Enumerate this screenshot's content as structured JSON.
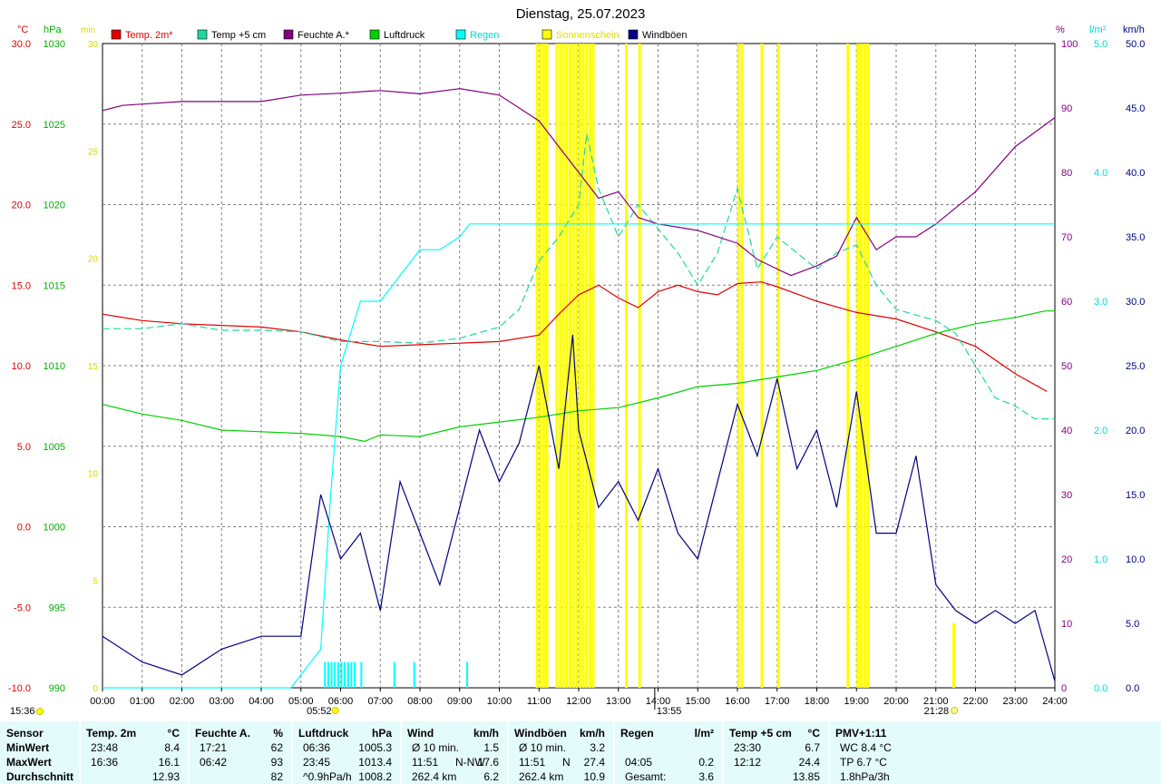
{
  "title": "Dienstag, 25.07.2023",
  "legend": [
    {
      "label": "Temp. 2m*",
      "color": "#e00000",
      "text_color": "#e00000"
    },
    {
      "label": "Temp +5 cm",
      "color": "#20d8a0",
      "text_color": "#000000"
    },
    {
      "label": "Feuchte A.*",
      "color": "#800080",
      "text_color": "#000000"
    },
    {
      "label": "Luftdruck",
      "color": "#00d000",
      "text_color": "#000000"
    },
    {
      "label": "Regen",
      "color": "#00ffff",
      "text_color": "#00d8d8"
    },
    {
      "label": "Sonnenschein",
      "color": "#ffff00",
      "text_color": "#e0e000"
    },
    {
      "label": "Windböen",
      "color": "#000080",
      "text_color": "#000000"
    }
  ],
  "axes": {
    "temp": {
      "unit": "°C",
      "color": "#e00000",
      "ticks": [
        "30.0",
        "25.0",
        "20.0",
        "15.0",
        "10.0",
        "5.0",
        "0.0",
        "-5.0",
        "-10.0"
      ]
    },
    "pressure": {
      "unit": "hPa",
      "color": "#00b000",
      "ticks": [
        "1030",
        "1025",
        "1020",
        "1015",
        "1010",
        "1005",
        "1000",
        "995",
        "990"
      ]
    },
    "sun": {
      "unit": "min",
      "color": "#d8d800",
      "ticks": [
        "30",
        "25",
        "20",
        "15",
        "10",
        "5",
        "0"
      ]
    },
    "humidity": {
      "unit": "%",
      "color": "#800080",
      "ticks": [
        "100",
        "90",
        "80",
        "70",
        "60",
        "50",
        "40",
        "30",
        "20",
        "10",
        "0"
      ]
    },
    "rain": {
      "unit": "l/m²",
      "color": "#00d8d8",
      "ticks": [
        "5.0",
        "4.0",
        "3.0",
        "2.0",
        "1.0",
        "0.0"
      ]
    },
    "wind": {
      "unit": "km/h",
      "color": "#000080",
      "ticks": [
        "50.0",
        "45.0",
        "40.0",
        "35.0",
        "30.0",
        "25.0",
        "20.0",
        "15.0",
        "10.0",
        "5.0",
        "0.0"
      ]
    },
    "time_ticks": [
      "00:00",
      "01:00",
      "02:00",
      "03:00",
      "04:00",
      "05:00",
      "06:00",
      "07:00",
      "08:00",
      "09:00",
      "10:00",
      "11:00",
      "12:00",
      "13:00",
      "14:00",
      "15:00",
      "16:00",
      "17:00",
      "18:00",
      "19:00",
      "20:00",
      "21:00",
      "22:00",
      "23:00",
      "24:00"
    ]
  },
  "markers": {
    "left_time": "15:36",
    "sunrise": "05:52",
    "noon": "13:55",
    "sunset": "21:28"
  },
  "chart_data": {
    "type": "line",
    "title": "Dienstag, 25.07.2023",
    "x_range": [
      "00:00",
      "24:00"
    ],
    "series": [
      {
        "name": "Temp. 2m*",
        "axis": "°C",
        "x": [
          "00:00",
          "01:00",
          "02:00",
          "03:00",
          "04:00",
          "05:00",
          "06:00",
          "07:00",
          "08:00",
          "09:00",
          "10:00",
          "11:00",
          "11:30",
          "12:00",
          "12:30",
          "13:00",
          "13:30",
          "14:00",
          "14:30",
          "15:00",
          "15:30",
          "16:00",
          "16:36",
          "17:00",
          "18:00",
          "19:00",
          "20:00",
          "21:00",
          "22:00",
          "23:00",
          "23:48"
        ],
        "y": [
          13.2,
          12.8,
          12.6,
          12.5,
          12.4,
          12.1,
          11.6,
          11.2,
          11.3,
          11.4,
          11.5,
          11.9,
          13.2,
          14.4,
          15.0,
          14.2,
          13.6,
          14.6,
          15.0,
          14.6,
          14.4,
          15.1,
          15.2,
          14.9,
          14.0,
          13.3,
          12.9,
          12.1,
          11.2,
          9.5,
          8.4
        ]
      },
      {
        "name": "Temp +5 cm",
        "axis": "°C",
        "x": [
          "00:00",
          "01:00",
          "02:00",
          "03:00",
          "04:00",
          "05:00",
          "06:00",
          "07:00",
          "08:00",
          "09:00",
          "10:00",
          "10:30",
          "11:00",
          "11:30",
          "12:00",
          "12:12",
          "12:30",
          "13:00",
          "13:30",
          "14:00",
          "14:30",
          "15:00",
          "15:30",
          "16:00",
          "16:30",
          "17:00",
          "17:30",
          "18:00",
          "18:30",
          "19:00",
          "19:30",
          "20:00",
          "21:00",
          "21:30",
          "22:00",
          "22:30",
          "23:00",
          "23:30",
          "24:00"
        ],
        "y": [
          12.3,
          12.3,
          12.6,
          12.2,
          12.2,
          12.1,
          11.5,
          11.5,
          11.4,
          11.7,
          12.4,
          13.5,
          16.5,
          18.0,
          20.0,
          24.4,
          21.0,
          18.0,
          20.0,
          18.5,
          17.0,
          15.0,
          17.0,
          21.0,
          16.0,
          18.0,
          17.0,
          16.0,
          17.0,
          17.5,
          15.0,
          13.5,
          12.8,
          12.0,
          10.0,
          8.0,
          7.5,
          6.7,
          6.7
        ]
      },
      {
        "name": "Feuchte A.*",
        "axis": "%",
        "x": [
          "00:00",
          "00:30",
          "01:00",
          "02:00",
          "03:00",
          "04:00",
          "05:00",
          "06:00",
          "06:42",
          "07:00",
          "08:00",
          "09:00",
          "10:00",
          "11:00",
          "11:30",
          "12:00",
          "12:30",
          "13:00",
          "13:30",
          "14:00",
          "15:00",
          "16:00",
          "16:30",
          "17:00",
          "17:21",
          "18:00",
          "18:30",
          "19:00",
          "19:30",
          "20:00",
          "20:30",
          "21:00",
          "22:00",
          "23:00",
          "24:00"
        ],
        "y": [
          89.6,
          90.4,
          90.6,
          91.0,
          91.0,
          91.0,
          92.0,
          92.3,
          92.6,
          92.7,
          92.2,
          93.0,
          92.0,
          88.0,
          84.0,
          80.0,
          76.0,
          77.0,
          73.0,
          72.0,
          71.0,
          69.0,
          66.5,
          65.0,
          64.0,
          65.5,
          67.0,
          73.0,
          68.0,
          70.0,
          70.0,
          72.0,
          77.0,
          84.0,
          88.5
        ]
      },
      {
        "name": "Luftdruck",
        "axis": "hPa",
        "x": [
          "00:00",
          "01:00",
          "02:00",
          "03:00",
          "04:00",
          "05:00",
          "06:00",
          "06:36",
          "07:00",
          "08:00",
          "09:00",
          "10:00",
          "11:00",
          "12:00",
          "13:00",
          "14:00",
          "15:00",
          "16:00",
          "17:00",
          "18:00",
          "19:00",
          "20:00",
          "21:00",
          "22:00",
          "23:00",
          "23:45",
          "24:00"
        ],
        "y": [
          1007.6,
          1007.0,
          1006.6,
          1006.0,
          1005.9,
          1005.8,
          1005.6,
          1005.3,
          1005.7,
          1005.6,
          1006.2,
          1006.5,
          1006.8,
          1007.2,
          1007.4,
          1008.0,
          1008.7,
          1008.9,
          1009.3,
          1009.7,
          1010.4,
          1011.2,
          1012.0,
          1012.6,
          1013.0,
          1013.4,
          1013.4
        ]
      },
      {
        "name": "Regen",
        "axis": "l/m²",
        "x": [
          "00:00",
          "04:45",
          "05:00",
          "05:30",
          "05:45",
          "06:00",
          "06:30",
          "07:00",
          "07:30",
          "08:00",
          "08:30",
          "09:00",
          "09:15",
          "10:00",
          "24:00"
        ],
        "y": [
          0.0,
          0.0,
          0.1,
          0.3,
          1.5,
          2.5,
          3.0,
          3.0,
          3.2,
          3.4,
          3.4,
          3.5,
          3.6,
          3.6,
          3.6
        ]
      },
      {
        "name": "Windböen",
        "axis": "km/h",
        "x": [
          "00:00",
          "01:00",
          "02:00",
          "03:00",
          "04:00",
          "05:00",
          "05:30",
          "06:00",
          "06:30",
          "07:00",
          "07:30",
          "08:00",
          "08:30",
          "09:00",
          "09:30",
          "10:00",
          "10:30",
          "11:00",
          "11:30",
          "11:51",
          "12:00",
          "12:30",
          "13:00",
          "13:30",
          "14:00",
          "14:30",
          "15:00",
          "15:30",
          "16:00",
          "16:30",
          "17:00",
          "17:30",
          "18:00",
          "18:30",
          "19:00",
          "19:30",
          "20:00",
          "20:30",
          "21:00",
          "21:30",
          "22:00",
          "22:30",
          "23:00",
          "23:30",
          "24:00"
        ],
        "y": [
          4.0,
          2.0,
          1.0,
          3.0,
          4.0,
          4.0,
          15.0,
          10.0,
          12.0,
          6.0,
          16.0,
          12.0,
          8.0,
          14.0,
          20.0,
          16.0,
          19.0,
          25.0,
          17.0,
          27.4,
          20.0,
          14.0,
          16.0,
          13.0,
          17.0,
          12.0,
          10.0,
          16.0,
          22.0,
          18.0,
          24.0,
          17.0,
          20.0,
          14.0,
          23.0,
          12.0,
          12.0,
          18.0,
          8.0,
          6.0,
          5.0,
          6.0,
          5.0,
          6.0,
          0.5
        ]
      }
    ],
    "bars": [
      {
        "name": "Sonnenschein",
        "axis": "min",
        "x": [
          "10:55",
          "11:00",
          "11:05",
          "11:10",
          "11:25",
          "11:30",
          "11:35",
          "11:40",
          "11:45",
          "11:50",
          "11:55",
          "12:00",
          "12:05",
          "12:10",
          "12:15",
          "12:20",
          "13:10",
          "13:30",
          "16:00",
          "16:05",
          "16:35",
          "17:00",
          "18:45",
          "19:00",
          "19:05",
          "19:10",
          "19:15",
          "21:25"
        ],
        "values": [
          30,
          30,
          30,
          30,
          30,
          30,
          30,
          30,
          30,
          30,
          30,
          30,
          30,
          30,
          30,
          30,
          30,
          30,
          30,
          30,
          30,
          30,
          30,
          30,
          30,
          30,
          30,
          3
        ]
      },
      {
        "name": "Regen",
        "axis": "l/m²",
        "x": [
          "05:35",
          "05:40",
          "05:45",
          "05:50",
          "05:55",
          "06:00",
          "06:05",
          "06:10",
          "06:15",
          "06:20",
          "06:30",
          "07:20",
          "07:50",
          "09:10"
        ],
        "values": [
          0.2,
          0.2,
          0.2,
          0.2,
          0.2,
          0.2,
          0.2,
          0.2,
          0.2,
          0.2,
          0.2,
          0.2,
          0.2,
          0.2
        ]
      }
    ]
  },
  "stats": {
    "columns": [
      {
        "title": "Sensor",
        "unit": "",
        "rows": [
          {
            "a": "MinWert"
          },
          {
            "a": "MaxWert"
          },
          {
            "a": "Durchschnitt"
          }
        ]
      },
      {
        "title": "Temp. 2m",
        "unit": "°C",
        "rows": [
          {
            "a": "23:48",
            "v": "8.4"
          },
          {
            "a": "16:36",
            "v": "16.1"
          },
          {
            "a": "",
            "v": "12.93"
          }
        ]
      },
      {
        "title": "Feuchte A.",
        "unit": "%",
        "rows": [
          {
            "a": "17:21",
            "v": "62"
          },
          {
            "a": "06:42",
            "v": "93"
          },
          {
            "a": "",
            "v": "82"
          }
        ]
      },
      {
        "title": "Luftdruck",
        "unit": "hPa",
        "rows": [
          {
            "a": "06:36",
            "v": "1005.3"
          },
          {
            "a": "23:45",
            "v": "1013.4"
          },
          {
            "a": "^0.9hPa/h",
            "v": "1008.2"
          }
        ]
      },
      {
        "title": "Wind",
        "unit": "km/h",
        "rows": [
          {
            "a": "Ø 10 min.",
            "v": "1.5"
          },
          {
            "a": "11:51",
            "b": "N-NW",
            "v": "17.6"
          },
          {
            "a": "262.4 km",
            "v": "6.2"
          }
        ]
      },
      {
        "title": "Windböen",
        "unit": "km/h",
        "rows": [
          {
            "a": "Ø 10 min.",
            "v": "3.2"
          },
          {
            "a": "11:51",
            "b": "N",
            "v": "27.4"
          },
          {
            "a": "262.4 km",
            "v": "10.9"
          }
        ]
      },
      {
        "title": "Regen",
        "unit": "l/m²",
        "rows": [
          {
            "a": "",
            "v": ""
          },
          {
            "a": "04:05",
            "v": "0.2"
          },
          {
            "a": "Gesamt:",
            "v": "3.6"
          }
        ]
      },
      {
        "title": "Temp +5 cm",
        "unit": "°C",
        "rows": [
          {
            "a": "23:30",
            "v": "6.7"
          },
          {
            "a": "12:12",
            "v": "24.4"
          },
          {
            "a": "",
            "v": "13.85"
          }
        ]
      },
      {
        "title": "PMV+1:11",
        "unit": "",
        "rows": [
          {
            "a": "WC 8.4 °C"
          },
          {
            "a": "TP 6.7 °C"
          },
          {
            "a": "1.8hPa/3h"
          }
        ]
      }
    ]
  }
}
